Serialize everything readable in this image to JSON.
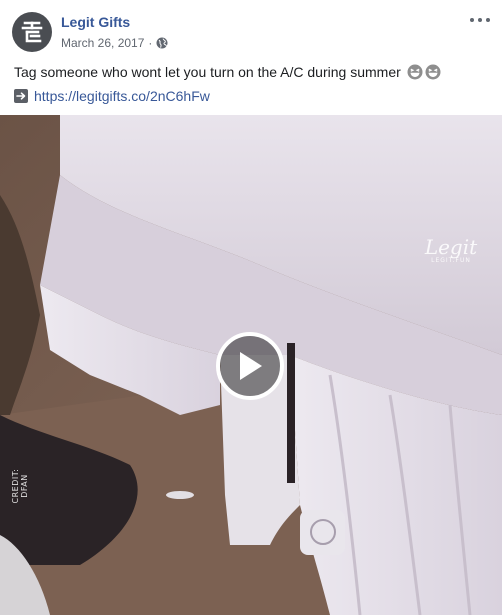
{
  "post": {
    "page_name": "Legit Gifts",
    "date": "March 26, 2017",
    "separator": "·",
    "caption": "Tag someone who wont let you turn on the A/C during summer",
    "emoji": [
      "grinning-squinting-face",
      "grinning-squinting-face"
    ],
    "link_url": "https://legitgifts.co/2nC6hFw",
    "icons": {
      "avatar": "legit-logo-icon",
      "privacy": "globe-icon",
      "menu": "more-options-icon",
      "link": "arrow-right-icon",
      "play": "play-icon"
    }
  },
  "video": {
    "watermark_brand": "Legit",
    "watermark_sub": "LEGIT.FUN",
    "credit": "CREDIT: DFAN"
  },
  "colors": {
    "link": "#385898",
    "meta": "#616770",
    "text": "#1c1e21",
    "avatar_bg": "#4a4d52"
  }
}
